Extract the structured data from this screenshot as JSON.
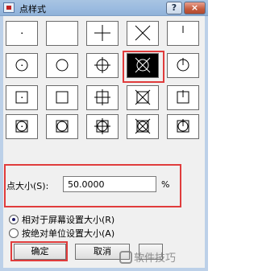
{
  "window": {
    "title": "点样式",
    "help_label": "?",
    "close_label": "×"
  },
  "point_styles": [
    {
      "name": "dot"
    },
    {
      "name": "blank"
    },
    {
      "name": "plus"
    },
    {
      "name": "cross"
    },
    {
      "name": "tick"
    },
    {
      "name": "circle-dot"
    },
    {
      "name": "circle"
    },
    {
      "name": "circle-plus"
    },
    {
      "name": "circle-cross",
      "selected": true
    },
    {
      "name": "circle-tick"
    },
    {
      "name": "square-dot"
    },
    {
      "name": "square"
    },
    {
      "name": "square-plus"
    },
    {
      "name": "square-cross"
    },
    {
      "name": "square-tick"
    },
    {
      "name": "square-circle-dot"
    },
    {
      "name": "square-circle"
    },
    {
      "name": "square-circle-plus"
    },
    {
      "name": "square-circle-cross"
    },
    {
      "name": "square-circle-tick"
    }
  ],
  "size": {
    "label": "点大小(S):",
    "value": "50.0000",
    "unit": "%"
  },
  "options": {
    "relative_label": "相对于屏幕设置大小(R)",
    "absolute_label": "按绝对单位设置大小(A)",
    "selected": "relative"
  },
  "buttons": {
    "ok": "确定",
    "cancel": "取消",
    "third": ""
  },
  "watermark": "软件技巧"
}
